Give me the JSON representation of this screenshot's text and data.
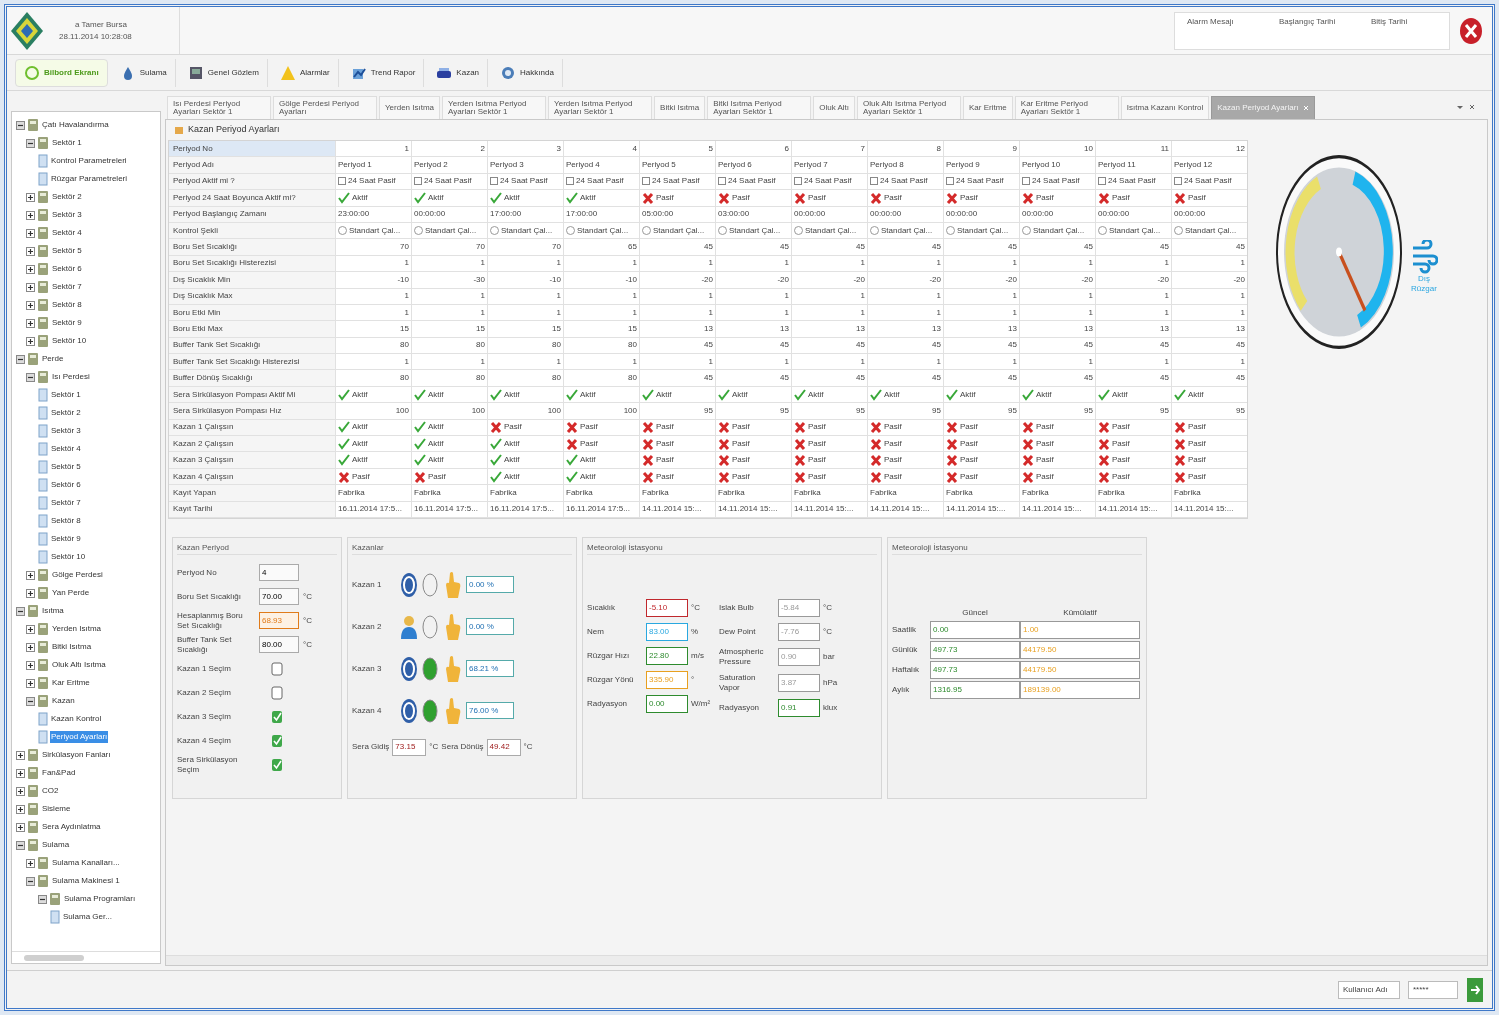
{
  "header": {
    "user": "a Tamer Bursa",
    "datetime": "28.11.2014 10:28:08",
    "alarm_columns": [
      "Alarm Mesajı",
      "Başlangıç Tarihi",
      "Bitiş Tarihi"
    ]
  },
  "toolbar": [
    {
      "label": "Bilbord Ekranı",
      "selected": true
    },
    {
      "label": "Sulama",
      "selected": false
    },
    {
      "label": "Genel Gözlem",
      "selected": false
    },
    {
      "label": "Alarmlar",
      "selected": false
    },
    {
      "label": "Trend Rapor",
      "selected": false
    },
    {
      "label": "Kazan",
      "selected": false
    },
    {
      "label": "Hakkında",
      "selected": false
    }
  ],
  "tabs": [
    {
      "label": "Isı Perdesi Periyod Ayarları Sektör 1",
      "selected": false
    },
    {
      "label": "Gölge Perdesi Periyod Ayarları",
      "selected": false
    },
    {
      "label": "Yerden Isıtma",
      "selected": false
    },
    {
      "label": "Yerden Isıtma Periyod Ayarları Sektör 1",
      "selected": false
    },
    {
      "label": "Yerden Isıtma Periyod Ayarları Sektör 1",
      "selected": false
    },
    {
      "label": "Bitki Isıtma",
      "selected": false
    },
    {
      "label": "Bitki Isıtma Periyod Ayarları Sektör 1",
      "selected": false
    },
    {
      "label": "Oluk Altı",
      "selected": false
    },
    {
      "label": "Oluk Altı Isıtma Periyod Ayarları Sektör 1",
      "selected": false
    },
    {
      "label": "Kar Eritme",
      "selected": false
    },
    {
      "label": "Kar Eritme Periyod Ayarları Sektör 1",
      "selected": false
    },
    {
      "label": "Isıtma Kazanı Kontrol",
      "selected": false
    },
    {
      "label": "Kazan Periyod Ayarları",
      "selected": true
    }
  ],
  "tree": [
    {
      "label": "Çatı Havalandırma",
      "kind": "folder",
      "expanded": true,
      "selected": false,
      "children": [
        {
          "label": "Sektör 1",
          "kind": "folder",
          "expanded": true,
          "selected": false,
          "children": [
            {
              "label": "Kontrol Parametreleri",
              "kind": "page",
              "selected": false
            },
            {
              "label": "Rüzgar Parametreleri",
              "kind": "page",
              "selected": false
            }
          ]
        },
        {
          "label": "Sektör 2",
          "kind": "folder",
          "expanded": false,
          "selected": false
        },
        {
          "label": "Sektör 3",
          "kind": "folder",
          "expanded": false,
          "selected": false
        },
        {
          "label": "Sektör 4",
          "kind": "folder",
          "expanded": false,
          "selected": false
        },
        {
          "label": "Sektör 5",
          "kind": "folder",
          "expanded": false,
          "selected": false
        },
        {
          "label": "Sektör 6",
          "kind": "folder",
          "expanded": false,
          "selected": false
        },
        {
          "label": "Sektör 7",
          "kind": "folder",
          "expanded": false,
          "selected": false
        },
        {
          "label": "Sektör 8",
          "kind": "folder",
          "expanded": false,
          "selected": false
        },
        {
          "label": "Sektör 9",
          "kind": "folder",
          "expanded": false,
          "selected": false
        },
        {
          "label": "Sektör 10",
          "kind": "folder",
          "expanded": false,
          "selected": false
        }
      ]
    },
    {
      "label": "Perde",
      "kind": "folder",
      "expanded": true,
      "selected": false,
      "children": [
        {
          "label": "Isı Perdesi",
          "kind": "folder",
          "expanded": true,
          "selected": false,
          "children": [
            {
              "label": "Sektör 1",
              "kind": "page",
              "selected": false
            },
            {
              "label": "Sektör 2",
              "kind": "page",
              "selected": false
            },
            {
              "label": "Sektör 3",
              "kind": "page",
              "selected": false
            },
            {
              "label": "Sektör 4",
              "kind": "page",
              "selected": false
            },
            {
              "label": "Sektör 5",
              "kind": "page",
              "selected": false
            },
            {
              "label": "Sektör 6",
              "kind": "page",
              "selected": false
            },
            {
              "label": "Sektör 7",
              "kind": "page",
              "selected": false
            },
            {
              "label": "Sektör 8",
              "kind": "page",
              "selected": false
            },
            {
              "label": "Sektör 9",
              "kind": "page",
              "selected": false
            },
            {
              "label": "Sektör 10",
              "kind": "page",
              "selected": false
            }
          ]
        },
        {
          "label": "Gölge Perdesi",
          "kind": "folder",
          "expanded": false,
          "selected": false
        },
        {
          "label": "Yan Perde",
          "kind": "folder",
          "expanded": false,
          "selected": false
        }
      ]
    },
    {
      "label": "Isıtma",
      "kind": "folder",
      "expanded": true,
      "selected": false,
      "children": [
        {
          "label": "Yerden Isıtma",
          "kind": "folder",
          "expanded": false,
          "selected": false
        },
        {
          "label": "Bitki Isıtma",
          "kind": "folder",
          "expanded": false,
          "selected": false
        },
        {
          "label": "Oluk Altı Isıtma",
          "kind": "folder",
          "expanded": false,
          "selected": false
        },
        {
          "label": "Kar Eritme",
          "kind": "folder",
          "expanded": false,
          "selected": false
        },
        {
          "label": "Kazan",
          "kind": "folder",
          "expanded": true,
          "selected": false,
          "children": [
            {
              "label": "Kazan Kontrol",
              "kind": "page",
              "selected": false
            },
            {
              "label": "Periyod Ayarları",
              "kind": "page",
              "selected": true
            }
          ]
        }
      ]
    },
    {
      "label": "Sirkülasyon Fanları",
      "kind": "folder",
      "expanded": false,
      "selected": false
    },
    {
      "label": "Fan&Pad",
      "kind": "folder",
      "expanded": false,
      "selected": false
    },
    {
      "label": "CO2",
      "kind": "folder",
      "expanded": false,
      "selected": false
    },
    {
      "label": "Sisleme",
      "kind": "folder",
      "expanded": false,
      "selected": false
    },
    {
      "label": "Sera Aydınlatma",
      "kind": "folder",
      "expanded": false,
      "selected": false
    },
    {
      "label": "Sulama",
      "kind": "folder",
      "expanded": true,
      "selected": false,
      "children": [
        {
          "label": "Sulama Kanalları...",
          "kind": "folder",
          "expanded": false,
          "selected": false
        },
        {
          "label": "Sulama Makinesi 1",
          "kind": "folder",
          "expanded": true,
          "selected": false,
          "children": [
            {
              "label": "Sulama Programları",
              "kind": "folder",
              "expanded": true,
              "selected": false,
              "children": [
                {
                  "label": "Sulama Ger...",
                  "kind": "page",
                  "selected": false
                }
              ]
            }
          ]
        }
      ]
    }
  ],
  "panel_title": "Kazan Periyod Ayarları",
  "grid": [
    {
      "label": "Periyod No",
      "kind": "number",
      "cells": [
        "1",
        "2",
        "3",
        "4",
        "5",
        "6",
        "7",
        "8",
        "9",
        "10",
        "11",
        "12"
      ]
    },
    {
      "label": "Periyod Adı",
      "kind": "text",
      "cells": [
        "Periyod 1",
        "Periyod 2",
        "Periyod 3",
        "Periyod 4",
        "Periyod 5",
        "Periyod 6",
        "Periyod 7",
        "Periyod 8",
        "Periyod 9",
        "Periyod 10",
        "Periyod 11",
        "Periyod 12"
      ]
    },
    {
      "label": "Periyod Aktif mi ?",
      "kind": "check",
      "cells": [
        {
          "checked": false,
          "text": "24 Saat Pasif"
        },
        {
          "checked": false,
          "text": "24 Saat Pasif"
        },
        {
          "checked": false,
          "text": "24 Saat Pasif"
        },
        {
          "checked": false,
          "text": "24 Saat Pasif"
        },
        {
          "checked": false,
          "text": "24 Saat Pasif"
        },
        {
          "checked": false,
          "text": "24 Saat Pasif"
        },
        {
          "checked": false,
          "text": "24 Saat Pasif"
        },
        {
          "checked": false,
          "text": "24 Saat Pasif"
        },
        {
          "checked": false,
          "text": "24 Saat Pasif"
        },
        {
          "checked": false,
          "text": "24 Saat Pasif"
        },
        {
          "checked": false,
          "text": "24 Saat Pasif"
        },
        {
          "checked": false,
          "text": "24 Saat Pasif"
        }
      ]
    },
    {
      "label": "Periyod 24 Saat Boyunca Aktif mi?",
      "kind": "status",
      "cells": [
        {
          "on": true,
          "text": "Aktif"
        },
        {
          "on": true,
          "text": "Aktif"
        },
        {
          "on": true,
          "text": "Aktif"
        },
        {
          "on": true,
          "text": "Aktif"
        },
        {
          "on": false,
          "text": "Pasif"
        },
        {
          "on": false,
          "text": "Pasif"
        },
        {
          "on": false,
          "text": "Pasif"
        },
        {
          "on": false,
          "text": "Pasif"
        },
        {
          "on": false,
          "text": "Pasif"
        },
        {
          "on": false,
          "text": "Pasif"
        },
        {
          "on": false,
          "text": "Pasif"
        },
        {
          "on": false,
          "text": "Pasif"
        }
      ]
    },
    {
      "label": "Periyod Başlangıç Zamanı",
      "kind": "text",
      "cells": [
        "23:00:00",
        "00:00:00",
        "17:00:00",
        "17:00:00",
        "05:00:00",
        "03:00:00",
        "00:00:00",
        "00:00:00",
        "00:00:00",
        "00:00:00",
        "00:00:00",
        "00:00:00"
      ]
    },
    {
      "label": "Kontrol Şekli",
      "kind": "radio",
      "cells": [
        {
          "selected": false,
          "text": "Standart Çal..."
        },
        {
          "selected": false,
          "text": "Standart Çal..."
        },
        {
          "selected": false,
          "text": "Standart Çal..."
        },
        {
          "selected": false,
          "text": "Standart Çal..."
        },
        {
          "selected": false,
          "text": "Standart Çal..."
        },
        {
          "selected": false,
          "text": "Standart Çal..."
        },
        {
          "selected": false,
          "text": "Standart Çal..."
        },
        {
          "selected": false,
          "text": "Standart Çal..."
        },
        {
          "selected": false,
          "text": "Standart Çal..."
        },
        {
          "selected": false,
          "text": "Standart Çal..."
        },
        {
          "selected": false,
          "text": "Standart Çal..."
        },
        {
          "selected": false,
          "text": "Standart Çal..."
        }
      ]
    },
    {
      "label": "Boru Set Sıcaklığı",
      "kind": "number",
      "cells": [
        "70",
        "70",
        "70",
        "65",
        "45",
        "45",
        "45",
        "45",
        "45",
        "45",
        "45",
        "45"
      ]
    },
    {
      "label": "Boru Set Sıcaklığı Histerezisi",
      "kind": "number",
      "cells": [
        "1",
        "1",
        "1",
        "1",
        "1",
        "1",
        "1",
        "1",
        "1",
        "1",
        "1",
        "1"
      ]
    },
    {
      "label": "Dış Sıcaklık Min",
      "kind": "number",
      "cells": [
        "-10",
        "-30",
        "-10",
        "-10",
        "-20",
        "-20",
        "-20",
        "-20",
        "-20",
        "-20",
        "-20",
        "-20"
      ]
    },
    {
      "label": "Dış Sıcaklık Max",
      "kind": "number",
      "cells": [
        "1",
        "1",
        "1",
        "1",
        "1",
        "1",
        "1",
        "1",
        "1",
        "1",
        "1",
        "1"
      ]
    },
    {
      "label": "Boru Etki Min",
      "kind": "number",
      "cells": [
        "1",
        "1",
        "1",
        "1",
        "1",
        "1",
        "1",
        "1",
        "1",
        "1",
        "1",
        "1"
      ]
    },
    {
      "label": "Boru Etki Max",
      "kind": "number",
      "cells": [
        "15",
        "15",
        "15",
        "15",
        "13",
        "13",
        "13",
        "13",
        "13",
        "13",
        "13",
        "13"
      ]
    },
    {
      "label": "Buffer Tank Set Sıcaklığı",
      "kind": "number",
      "cells": [
        "80",
        "80",
        "80",
        "80",
        "45",
        "45",
        "45",
        "45",
        "45",
        "45",
        "45",
        "45"
      ]
    },
    {
      "label": "Buffer Tank Set Sıcaklığı Histerezisi",
      "kind": "number",
      "cells": [
        "1",
        "1",
        "1",
        "1",
        "1",
        "1",
        "1",
        "1",
        "1",
        "1",
        "1",
        "1"
      ]
    },
    {
      "label": "Buffer Dönüş Sıcaklığı",
      "kind": "number",
      "cells": [
        "80",
        "80",
        "80",
        "80",
        "45",
        "45",
        "45",
        "45",
        "45",
        "45",
        "45",
        "45"
      ]
    },
    {
      "label": "Sera Sirkülasyon Pompası Aktif Mi",
      "kind": "status",
      "cells": [
        {
          "on": true,
          "text": "Aktif"
        },
        {
          "on": true,
          "text": "Aktif"
        },
        {
          "on": true,
          "text": "Aktif"
        },
        {
          "on": true,
          "text": "Aktif"
        },
        {
          "on": true,
          "text": "Aktif"
        },
        {
          "on": true,
          "text": "Aktif"
        },
        {
          "on": true,
          "text": "Aktif"
        },
        {
          "on": true,
          "text": "Aktif"
        },
        {
          "on": true,
          "text": "Aktif"
        },
        {
          "on": true,
          "text": "Aktif"
        },
        {
          "on": true,
          "text": "Aktif"
        },
        {
          "on": true,
          "text": "Aktif"
        }
      ]
    },
    {
      "label": "Sera Sirkülasyon Pompası Hız",
      "kind": "number",
      "cells": [
        "100",
        "100",
        "100",
        "100",
        "95",
        "95",
        "95",
        "95",
        "95",
        "95",
        "95",
        "95"
      ]
    },
    {
      "label": "Kazan 1 Çalışsın",
      "kind": "status",
      "cells": [
        {
          "on": true,
          "text": "Aktif"
        },
        {
          "on": true,
          "text": "Aktif"
        },
        {
          "on": false,
          "text": "Pasif"
        },
        {
          "on": false,
          "text": "Pasif"
        },
        {
          "on": false,
          "text": "Pasif"
        },
        {
          "on": false,
          "text": "Pasif"
        },
        {
          "on": false,
          "text": "Pasif"
        },
        {
          "on": false,
          "text": "Pasif"
        },
        {
          "on": false,
          "text": "Pasif"
        },
        {
          "on": false,
          "text": "Pasif"
        },
        {
          "on": false,
          "text": "Pasif"
        },
        {
          "on": false,
          "text": "Pasif"
        }
      ]
    },
    {
      "label": "Kazan 2 Çalışsın",
      "kind": "status",
      "cells": [
        {
          "on": true,
          "text": "Aktif"
        },
        {
          "on": true,
          "text": "Aktif"
        },
        {
          "on": true,
          "text": "Aktif"
        },
        {
          "on": false,
          "text": "Pasif"
        },
        {
          "on": false,
          "text": "Pasif"
        },
        {
          "on": false,
          "text": "Pasif"
        },
        {
          "on": false,
          "text": "Pasif"
        },
        {
          "on": false,
          "text": "Pasif"
        },
        {
          "on": false,
          "text": "Pasif"
        },
        {
          "on": false,
          "text": "Pasif"
        },
        {
          "on": false,
          "text": "Pasif"
        },
        {
          "on": false,
          "text": "Pasif"
        }
      ]
    },
    {
      "label": "Kazan 3 Çalışsın",
      "kind": "status",
      "cells": [
        {
          "on": true,
          "text": "Aktif"
        },
        {
          "on": true,
          "text": "Aktif"
        },
        {
          "on": true,
          "text": "Aktif"
        },
        {
          "on": true,
          "text": "Aktif"
        },
        {
          "on": false,
          "text": "Pasif"
        },
        {
          "on": false,
          "text": "Pasif"
        },
        {
          "on": false,
          "text": "Pasif"
        },
        {
          "on": false,
          "text": "Pasif"
        },
        {
          "on": false,
          "text": "Pasif"
        },
        {
          "on": false,
          "text": "Pasif"
        },
        {
          "on": false,
          "text": "Pasif"
        },
        {
          "on": false,
          "text": "Pasif"
        }
      ]
    },
    {
      "label": "Kazan 4 Çalışsın",
      "kind": "status",
      "cells": [
        {
          "on": false,
          "text": "Pasif"
        },
        {
          "on": false,
          "text": "Pasif"
        },
        {
          "on": true,
          "text": "Aktif"
        },
        {
          "on": true,
          "text": "Aktif"
        },
        {
          "on": false,
          "text": "Pasif"
        },
        {
          "on": false,
          "text": "Pasif"
        },
        {
          "on": false,
          "text": "Pasif"
        },
        {
          "on": false,
          "text": "Pasif"
        },
        {
          "on": false,
          "text": "Pasif"
        },
        {
          "on": false,
          "text": "Pasif"
        },
        {
          "on": false,
          "text": "Pasif"
        },
        {
          "on": false,
          "text": "Pasif"
        }
      ]
    },
    {
      "label": "Kayıt Yapan",
      "kind": "text",
      "cells": [
        "Fabrika",
        "Fabrika",
        "Fabrika",
        "Fabrika",
        "Fabrika",
        "Fabrika",
        "Fabrika",
        "Fabrika",
        "Fabrika",
        "Fabrika",
        "Fabrika",
        "Fabrika"
      ]
    },
    {
      "label": "Kayıt Tarihi",
      "kind": "text",
      "cells": [
        "16.11.2014 17:5...",
        "16.11.2014 17:5...",
        "16.11.2014 17:5...",
        "16.11.2014 17:5...",
        "14.11.2014 15:...",
        "14.11.2014 15:...",
        "14.11.2014 15:...",
        "14.11.2014 15:...",
        "14.11.2014 15:...",
        "14.11.2014 15:...",
        "14.11.2014 15:...",
        "14.11.2014 15:..."
      ]
    }
  ],
  "wind_label": "Dış Rüzgar",
  "boiler_period": {
    "title": "Kazan Periyod",
    "fields": [
      {
        "kind": "field",
        "label": "Periyod No",
        "value": "4"
      },
      {
        "kind": "field",
        "label": "Boru Set Sıcaklığı",
        "value": "70.00",
        "unit": "°C"
      },
      {
        "kind": "field",
        "label": "Hesaplanmış Boru Set Sıcaklığı",
        "value": "68.93",
        "unit": "°C",
        "color": "#e07b1a"
      },
      {
        "kind": "field",
        "label": "Buffer Tank Set Sıcaklığı",
        "value": "80.00",
        "unit": "°C"
      },
      {
        "kind": "checkbox",
        "label": "Kazan 1 Seçim",
        "checked": false
      },
      {
        "kind": "checkbox",
        "label": "Kazan 2 Seçim",
        "checked": false
      },
      {
        "kind": "checkbox",
        "label": "Kazan 3 Seçim",
        "checked": true
      },
      {
        "kind": "checkbox",
        "label": "Kazan 4 Seçim",
        "checked": true
      },
      {
        "kind": "checkbox",
        "label": "Sera Sirkülasyon Seçim",
        "checked": true
      }
    ]
  },
  "boilers": {
    "title": "Kazanlar",
    "items": [
      {
        "label": "Kazan 1",
        "kind": "auto",
        "running": false,
        "value": "0.00 %"
      },
      {
        "label": "Kazan 2",
        "kind": "manual",
        "running": false,
        "value": "0.00 %"
      },
      {
        "label": "Kazan 3",
        "kind": "auto",
        "running": true,
        "value": "68.21 %"
      },
      {
        "label": "Kazan 4",
        "kind": "auto",
        "running": true,
        "value": "76.00 %"
      }
    ],
    "supply": {
      "label": "Sera Gidiş",
      "value": "73.15",
      "unit": "°C"
    },
    "return": {
      "label": "Sera Dönüş",
      "value": "49.42",
      "unit": "°C"
    }
  },
  "weather": {
    "title": "Meteoroloji İstasyonu",
    "left": [
      {
        "label": "Sıcaklık",
        "value": "-5.10",
        "unit": "°C",
        "color": "#c0282d"
      },
      {
        "label": "Nem",
        "value": "83.00",
        "unit": "%",
        "color": "#29a8e0"
      },
      {
        "label": "Rüzgar Hızı",
        "value": "22.80",
        "unit": "m/s",
        "color": "#2e8b2e"
      },
      {
        "label": "Rüzgar Yönü",
        "value": "335.90",
        "unit": "°",
        "color": "#e8a020"
      },
      {
        "label": "Radyasyon",
        "value": "0.00",
        "unit": "W/m²",
        "color": "#2e8b2e"
      }
    ],
    "right": [
      {
        "label": "Islak Bulb",
        "value": "-5.84",
        "unit": "°C",
        "color": "#9a9a9a"
      },
      {
        "label": "Dew Point",
        "value": "-7.76",
        "unit": "°C",
        "color": "#9a9a9a"
      },
      {
        "label": "Atmospheric Pressure",
        "value": "0.90",
        "unit": "bar",
        "color": "#9a9a9a"
      },
      {
        "label": "Saturation Vapor",
        "value": "3.87",
        "unit": "hPa",
        "color": "#9a9a9a"
      },
      {
        "label": "Radyasyon",
        "value": "0.91",
        "unit": "klux",
        "color": "#2e8b2e"
      }
    ]
  },
  "energy": {
    "title": "Meteoroloji İstasyonu",
    "columns": [
      "Güncel",
      "Kümülatif"
    ],
    "rows": [
      {
        "label": "Saatlik",
        "values": [
          "0.00",
          "1.00"
        ]
      },
      {
        "label": "Günlük",
        "values": [
          "497.73",
          "44179.50"
        ]
      },
      {
        "label": "Haftalık",
        "values": [
          "497.73",
          "44179.50"
        ]
      },
      {
        "label": "Aylık",
        "values": [
          "1316.95",
          "189139.00"
        ]
      }
    ]
  },
  "status_bar": {
    "user_label": "Kullanıcı Adı",
    "password": "*****"
  }
}
